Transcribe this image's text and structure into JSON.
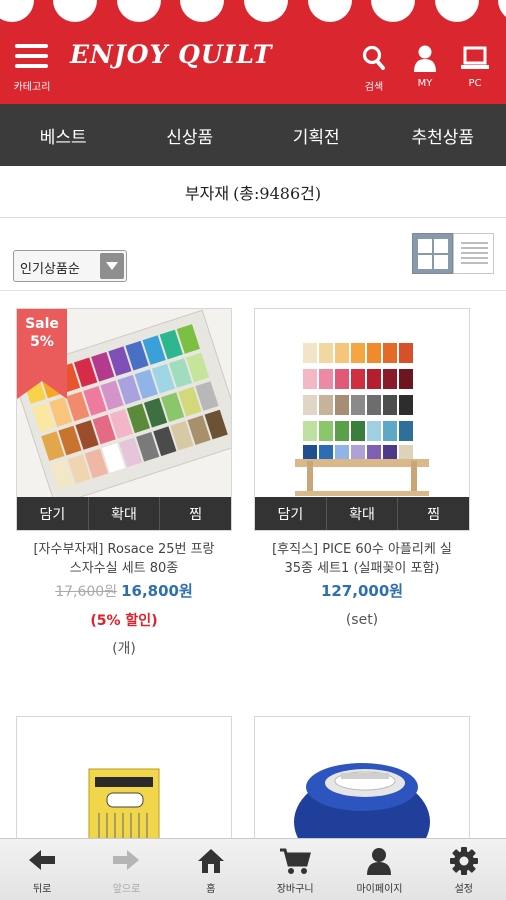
{
  "header": {
    "menu_label": "카테고리",
    "logo_text": "ENJOY QUILT",
    "search_label": "검색",
    "my_label": "MY",
    "pc_label": "PC",
    "brand_color": "#d9262f"
  },
  "nav": {
    "items": [
      "베스트",
      "신상품",
      "기획전",
      "추천상품"
    ]
  },
  "page_title": {
    "label": "부자재",
    "count": "(총:9486건)"
  },
  "sort": {
    "selected": "인기상품순"
  },
  "view_modes": [
    "grid-view-icon",
    "list-view-icon"
  ],
  "products": [
    {
      "sale_badge_line1": "Sale",
      "sale_badge_line2": "5%",
      "actions": [
        "담기",
        "확대",
        "찜"
      ],
      "name_line1": "[자수부자재] Rosace 25번 프랑",
      "name_line2": "스자수실 세트 80종",
      "old_price": "17,600원",
      "price": "16,800원",
      "discount": "(5% 할인)",
      "unit": "(개)"
    },
    {
      "actions": [
        "담기",
        "확대",
        "찜"
      ],
      "name_line1": "[후직스] PICE 60수 아플리케 실",
      "name_line2": "35종 세트1 (실패꽂이 포함)",
      "price": "127,000원",
      "unit": "(set)"
    }
  ],
  "tabbar": {
    "items": [
      "뒤로",
      "앞으로",
      "홈",
      "장바구니",
      "마이페이지",
      "설정"
    ]
  },
  "colors": {
    "nav_bg": "#3b3b3b",
    "price_blue": "#2e6fb0",
    "discount_red": "#e0202a",
    "sale_badge": "#ea5b5b"
  }
}
